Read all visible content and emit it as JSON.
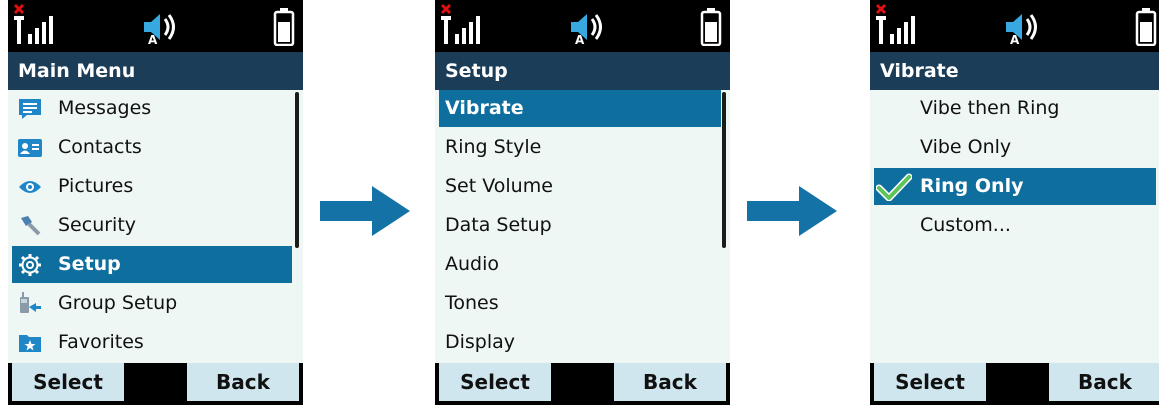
{
  "colors": {
    "title_bar": "#1c3d57",
    "selection": "#0e6f9f",
    "content_bg": "#eef7f3",
    "softkey_bg": "#cfe6ee",
    "arrow": "#1472a6",
    "check": "#5fc45a"
  },
  "status_icons": [
    "signal-no-service-icon",
    "speaker-auto-icon",
    "battery-icon"
  ],
  "screens": [
    {
      "title": "Main Menu",
      "items": [
        {
          "label": "Messages",
          "icon": "message-icon",
          "selected": false
        },
        {
          "label": "Contacts",
          "icon": "contact-card-icon",
          "selected": false
        },
        {
          "label": "Pictures",
          "icon": "eye-icon",
          "selected": false
        },
        {
          "label": "Security",
          "icon": "key-icon",
          "selected": false
        },
        {
          "label": "Setup",
          "icon": "gear-icon",
          "selected": true
        },
        {
          "label": "Group Setup",
          "icon": "group-radio-icon",
          "selected": false
        },
        {
          "label": "Favorites",
          "icon": "favorites-folder-icon",
          "selected": false
        }
      ],
      "softkeys": {
        "left": "Select",
        "right": "Back"
      }
    },
    {
      "title": "Setup",
      "items": [
        {
          "label": "Vibrate",
          "selected": true
        },
        {
          "label": "Ring Style",
          "selected": false
        },
        {
          "label": "Set Volume",
          "selected": false
        },
        {
          "label": "Data Setup",
          "selected": false
        },
        {
          "label": "Audio",
          "selected": false
        },
        {
          "label": "Tones",
          "selected": false
        },
        {
          "label": "Display",
          "selected": false
        }
      ],
      "softkeys": {
        "left": "Select",
        "right": "Back"
      }
    },
    {
      "title": "Vibrate",
      "items": [
        {
          "label": "Vibe then Ring",
          "selected": false,
          "checked": false
        },
        {
          "label": "Vibe Only",
          "selected": false,
          "checked": false
        },
        {
          "label": "Ring Only",
          "selected": true,
          "checked": true
        },
        {
          "label": "Custom...",
          "selected": false,
          "checked": false
        }
      ],
      "softkeys": {
        "left": "Select",
        "right": "Back"
      }
    }
  ],
  "arrows": [
    "arrow-right-icon",
    "arrow-right-icon"
  ]
}
